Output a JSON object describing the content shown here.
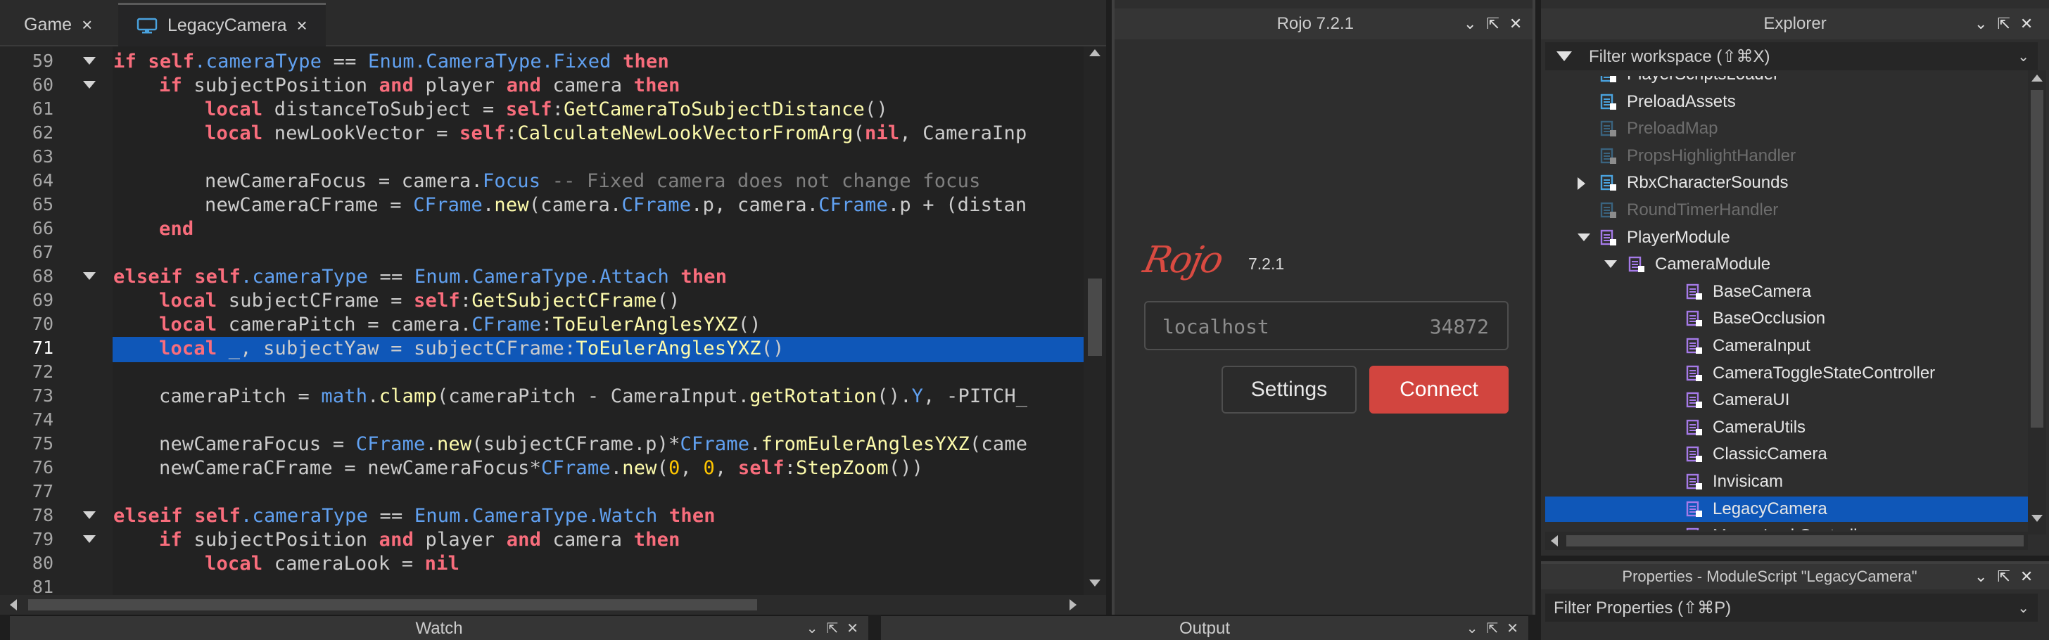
{
  "tabs": [
    {
      "label": "Game",
      "close": "×"
    },
    {
      "label": "LegacyCamera",
      "close": "×"
    }
  ],
  "editor": {
    "current_line": 71,
    "lines": [
      {
        "n": "59",
        "fold": true,
        "segs": [
          [
            "kw",
            "if "
          ],
          [
            "kw",
            "self"
          ],
          [
            "mb",
            ".cameraType"
          ],
          [
            "op",
            " == "
          ],
          [
            "mb",
            "Enum.CameraType.Fixed"
          ],
          [
            "op",
            " "
          ],
          [
            "kw",
            "then"
          ]
        ],
        "indent": 1
      },
      {
        "n": "60",
        "fold": true,
        "segs": [
          [
            "kw",
            "if "
          ],
          [
            "op",
            "subjectPosition "
          ],
          [
            "kw",
            "and "
          ],
          [
            "op",
            "player "
          ],
          [
            "kw",
            "and "
          ],
          [
            "op",
            "camera "
          ],
          [
            "kw",
            "then"
          ]
        ],
        "indent": 2
      },
      {
        "n": "61",
        "fold": false,
        "segs": [
          [
            "kw",
            "local "
          ],
          [
            "op",
            "distanceToSubject = "
          ],
          [
            "kw",
            "self"
          ],
          [
            "op",
            ":"
          ],
          [
            "fn",
            "GetCameraToSubjectDistance"
          ],
          [
            "op",
            "()"
          ]
        ],
        "indent": 3
      },
      {
        "n": "62",
        "fold": false,
        "segs": [
          [
            "kw",
            "local "
          ],
          [
            "op",
            "newLookVector = "
          ],
          [
            "kw",
            "self"
          ],
          [
            "op",
            ":"
          ],
          [
            "fn",
            "CalculateNewLookVectorFromArg"
          ],
          [
            "op",
            "("
          ],
          [
            "kw",
            "nil"
          ],
          [
            "op",
            ", CameraInp"
          ]
        ],
        "indent": 3
      },
      {
        "n": "63",
        "fold": false,
        "segs": [],
        "indent": 0
      },
      {
        "n": "64",
        "fold": false,
        "segs": [
          [
            "op",
            "newCameraFocus = camera."
          ],
          [
            "mb",
            "Focus"
          ],
          [
            "op",
            " "
          ],
          [
            "cm",
            "-- Fixed camera does not change focus"
          ]
        ],
        "indent": 3
      },
      {
        "n": "65",
        "fold": false,
        "segs": [
          [
            "op",
            "newCameraCFrame = "
          ],
          [
            "mb",
            "CFrame"
          ],
          [
            "op",
            "."
          ],
          [
            "fn",
            "new"
          ],
          [
            "op",
            "(camera."
          ],
          [
            "mb",
            "CFrame"
          ],
          [
            "op",
            ".p, camera."
          ],
          [
            "mb",
            "CFrame"
          ],
          [
            "op",
            ".p + (distan"
          ]
        ],
        "indent": 3
      },
      {
        "n": "66",
        "fold": false,
        "segs": [
          [
            "kw",
            "end"
          ]
        ],
        "indent": 2
      },
      {
        "n": "67",
        "fold": false,
        "segs": [],
        "indent": 0
      },
      {
        "n": "68",
        "fold": true,
        "segs": [
          [
            "kw",
            "elseif "
          ],
          [
            "kw",
            "self"
          ],
          [
            "mb",
            ".cameraType"
          ],
          [
            "op",
            " == "
          ],
          [
            "mb",
            "Enum.CameraType.Attach"
          ],
          [
            "op",
            " "
          ],
          [
            "kw",
            "then"
          ]
        ],
        "indent": 1
      },
      {
        "n": "69",
        "fold": false,
        "segs": [
          [
            "kw",
            "local "
          ],
          [
            "op",
            "subjectCFrame = "
          ],
          [
            "kw",
            "self"
          ],
          [
            "op",
            ":"
          ],
          [
            "fn",
            "GetSubjectCFrame"
          ],
          [
            "op",
            "()"
          ]
        ],
        "indent": 2
      },
      {
        "n": "70",
        "fold": false,
        "segs": [
          [
            "kw",
            "local "
          ],
          [
            "op",
            "cameraPitch = camera."
          ],
          [
            "mb",
            "CFrame"
          ],
          [
            "op",
            ":"
          ],
          [
            "fn",
            "ToEulerAnglesYXZ"
          ],
          [
            "op",
            "()"
          ]
        ],
        "indent": 2
      },
      {
        "n": "71",
        "fold": false,
        "segs": [
          [
            "kw",
            "local "
          ],
          [
            "op",
            "_, subjectYaw = subjectCFrame:"
          ],
          [
            "fn",
            "ToEulerAnglesYXZ"
          ],
          [
            "op",
            "()"
          ]
        ],
        "indent": 2
      },
      {
        "n": "72",
        "fold": false,
        "segs": [],
        "indent": 0
      },
      {
        "n": "73",
        "fold": false,
        "segs": [
          [
            "op",
            "cameraPitch = "
          ],
          [
            "mb",
            "math"
          ],
          [
            "op",
            "."
          ],
          [
            "fn",
            "clamp"
          ],
          [
            "op",
            "(cameraPitch - CameraInput."
          ],
          [
            "fn",
            "getRotation"
          ],
          [
            "op",
            "()."
          ],
          [
            "mb",
            "Y"
          ],
          [
            "op",
            ", -PITCH_"
          ]
        ],
        "indent": 2
      },
      {
        "n": "74",
        "fold": false,
        "segs": [],
        "indent": 0
      },
      {
        "n": "75",
        "fold": false,
        "segs": [
          [
            "op",
            "newCameraFocus = "
          ],
          [
            "mb",
            "CFrame"
          ],
          [
            "op",
            "."
          ],
          [
            "fn",
            "new"
          ],
          [
            "op",
            "(subjectCFrame.p)*"
          ],
          [
            "mb",
            "CFrame"
          ],
          [
            "op",
            "."
          ],
          [
            "fn",
            "fromEulerAnglesYXZ"
          ],
          [
            "op",
            "(came"
          ]
        ],
        "indent": 2
      },
      {
        "n": "76",
        "fold": false,
        "segs": [
          [
            "op",
            "newCameraCFrame = newCameraFocus*"
          ],
          [
            "mb",
            "CFrame"
          ],
          [
            "op",
            "."
          ],
          [
            "fn",
            "new"
          ],
          [
            "op",
            "("
          ],
          [
            "nu",
            "0"
          ],
          [
            "op",
            ", "
          ],
          [
            "nu",
            "0"
          ],
          [
            "op",
            ", "
          ],
          [
            "kw",
            "self"
          ],
          [
            "op",
            ":"
          ],
          [
            "fn",
            "StepZoom"
          ],
          [
            "op",
            "())"
          ]
        ],
        "indent": 2
      },
      {
        "n": "77",
        "fold": false,
        "segs": [],
        "indent": 0
      },
      {
        "n": "78",
        "fold": true,
        "segs": [
          [
            "kw",
            "elseif "
          ],
          [
            "kw",
            "self"
          ],
          [
            "mb",
            ".cameraType"
          ],
          [
            "op",
            " == "
          ],
          [
            "mb",
            "Enum.CameraType.Watch"
          ],
          [
            "op",
            " "
          ],
          [
            "kw",
            "then"
          ]
        ],
        "indent": 1
      },
      {
        "n": "79",
        "fold": true,
        "segs": [
          [
            "kw",
            "if "
          ],
          [
            "op",
            "subjectPosition "
          ],
          [
            "kw",
            "and "
          ],
          [
            "op",
            "player "
          ],
          [
            "kw",
            "and "
          ],
          [
            "op",
            "camera "
          ],
          [
            "kw",
            "then"
          ]
        ],
        "indent": 2
      },
      {
        "n": "80",
        "fold": false,
        "segs": [
          [
            "kw",
            "local "
          ],
          [
            "op",
            "cameraLook = "
          ],
          [
            "kw",
            "nil"
          ]
        ],
        "indent": 3
      },
      {
        "n": "81",
        "fold": false,
        "segs": [],
        "indent": 0
      }
    ]
  },
  "bottom_panels": {
    "watch_title": "Watch",
    "output_title": "Output"
  },
  "rojo": {
    "title": "Rojo 7.2.1",
    "logo_text": "Rojo",
    "version": "7.2.1",
    "host": "localhost",
    "port": "34872",
    "settings_label": "Settings",
    "connect_label": "Connect",
    "accent_color": "#d2453f"
  },
  "explorer": {
    "title": "Explorer",
    "filter_placeholder": "Filter workspace (⇧⌘X)",
    "items": [
      {
        "label": "PlayerScriptsLoader",
        "level": 1,
        "icon": "localscript-icon",
        "dim": false,
        "expander": "none"
      },
      {
        "label": "PreloadAssets",
        "level": 1,
        "icon": "localscript-icon",
        "dim": false,
        "expander": "none"
      },
      {
        "label": "PreloadMap",
        "level": 1,
        "icon": "localscript-icon",
        "dim": true,
        "expander": "none"
      },
      {
        "label": "PropsHighlightHandler",
        "level": 1,
        "icon": "localscript-icon",
        "dim": true,
        "expander": "none"
      },
      {
        "label": "RbxCharacterSounds",
        "level": 1,
        "icon": "localscript-icon",
        "dim": false,
        "expander": "collapsed"
      },
      {
        "label": "RoundTimerHandler",
        "level": 1,
        "icon": "localscript-icon",
        "dim": true,
        "expander": "none"
      },
      {
        "label": "PlayerModule",
        "level": 1,
        "icon": "modulescript-icon",
        "dim": false,
        "expander": "expanded"
      },
      {
        "label": "CameraModule",
        "level": 2,
        "icon": "modulescript-icon",
        "dim": false,
        "expander": "expanded"
      },
      {
        "label": "BaseCamera",
        "level": 3,
        "icon": "modulescript-icon",
        "dim": false,
        "expander": "none"
      },
      {
        "label": "BaseOcclusion",
        "level": 3,
        "icon": "modulescript-icon",
        "dim": false,
        "expander": "none"
      },
      {
        "label": "CameraInput",
        "level": 3,
        "icon": "modulescript-icon",
        "dim": false,
        "expander": "none"
      },
      {
        "label": "CameraToggleStateController",
        "level": 3,
        "icon": "modulescript-icon",
        "dim": false,
        "expander": "none"
      },
      {
        "label": "CameraUI",
        "level": 3,
        "icon": "modulescript-icon",
        "dim": false,
        "expander": "none"
      },
      {
        "label": "CameraUtils",
        "level": 3,
        "icon": "modulescript-icon",
        "dim": false,
        "expander": "none"
      },
      {
        "label": "ClassicCamera",
        "level": 3,
        "icon": "modulescript-icon",
        "dim": false,
        "expander": "none"
      },
      {
        "label": "Invisicam",
        "level": 3,
        "icon": "modulescript-icon",
        "dim": false,
        "expander": "none"
      },
      {
        "label": "LegacyCamera",
        "level": 3,
        "icon": "modulescript-icon",
        "dim": false,
        "expander": "none",
        "selected": true
      },
      {
        "label": "MouseLockController",
        "level": 3,
        "icon": "modulescript-icon",
        "dim": false,
        "expander": "none"
      }
    ]
  },
  "properties": {
    "title": "Properties - ModuleScript \"LegacyCamera\"",
    "filter_placeholder": "Filter Properties (⇧⌘P)"
  },
  "colors": {
    "selection": "#0f57b8",
    "keyword": "#f86d7c",
    "function": "#fdfbac",
    "member": "#61a1f1",
    "number": "#ffc600",
    "comment": "#808080",
    "localscript_icon": "#4aa3df",
    "modulescript_icon": "#a57ae8"
  }
}
